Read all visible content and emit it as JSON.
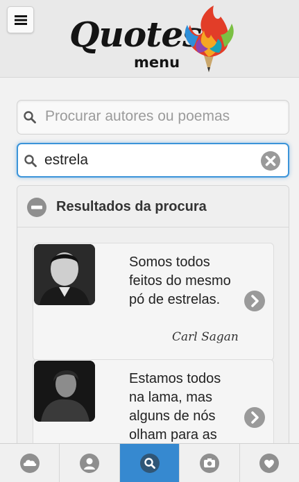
{
  "header": {
    "menu_icon": "hamburger-icon",
    "logo_word": "Quotes",
    "logo_sub": "menu"
  },
  "search_authors": {
    "icon": "search-icon",
    "placeholder": "Procurar autores ou poemas"
  },
  "search_quotes": {
    "icon": "search-icon",
    "value": "estrela",
    "clear_icon": "clear-icon",
    "accent": "#3b94d9"
  },
  "results": {
    "toggle_icon": "minus-icon",
    "title": "Resultados da procura",
    "items": [
      {
        "text": "Somos todos feitos do mesmo pó de estrelas.",
        "author": "Carl Sagan",
        "arrow_icon": "chevron-right-icon"
      },
      {
        "text": "Estamos todos na lama, mas alguns de nós olham para as",
        "author": "",
        "arrow_icon": "chevron-right-icon"
      }
    ]
  },
  "nav": {
    "active_color": "#3689d0",
    "items": [
      "cloud-icon",
      "user-icon",
      "search-icon",
      "camera-icon",
      "heart-icon"
    ],
    "active_index": 2
  }
}
